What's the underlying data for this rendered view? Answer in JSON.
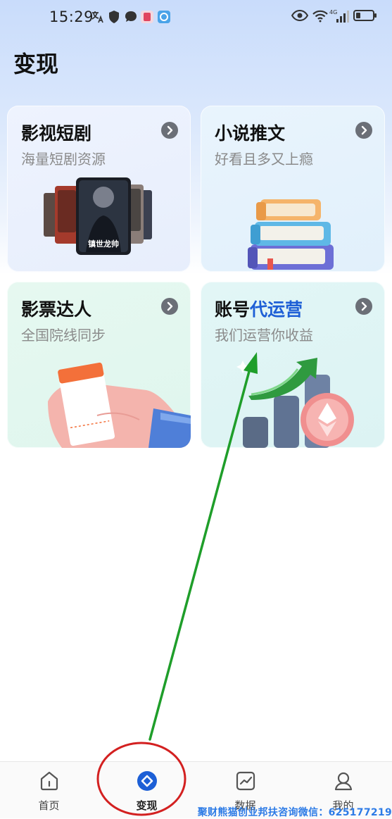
{
  "status_bar": {
    "time": "15:29"
  },
  "page_title": "变现",
  "cards": [
    {
      "title": "影视短剧",
      "subtitle": "海量短剧资源"
    },
    {
      "title": "小说推文",
      "subtitle": "好看且多又上瘾"
    },
    {
      "title": "影票达人",
      "subtitle": "全国院线同步"
    },
    {
      "title_plain": "账号",
      "title_accent": "代运营",
      "subtitle": "我们运营你收益"
    }
  ],
  "poster_caption": "镇世龙帅",
  "nav": [
    {
      "label": "首页",
      "icon": "home-icon"
    },
    {
      "label": "变现",
      "icon": "monetize-icon",
      "active": true
    },
    {
      "label": "数据",
      "icon": "chart-icon"
    },
    {
      "label": "我的",
      "icon": "profile-icon"
    }
  ],
  "watermark": "聚财熊猫创业邦扶咨询微信：625177219",
  "colors": {
    "accent": "#1e5fd6",
    "annotation_arrow": "#1f9e2a",
    "annotation_circle": "#d32020"
  }
}
